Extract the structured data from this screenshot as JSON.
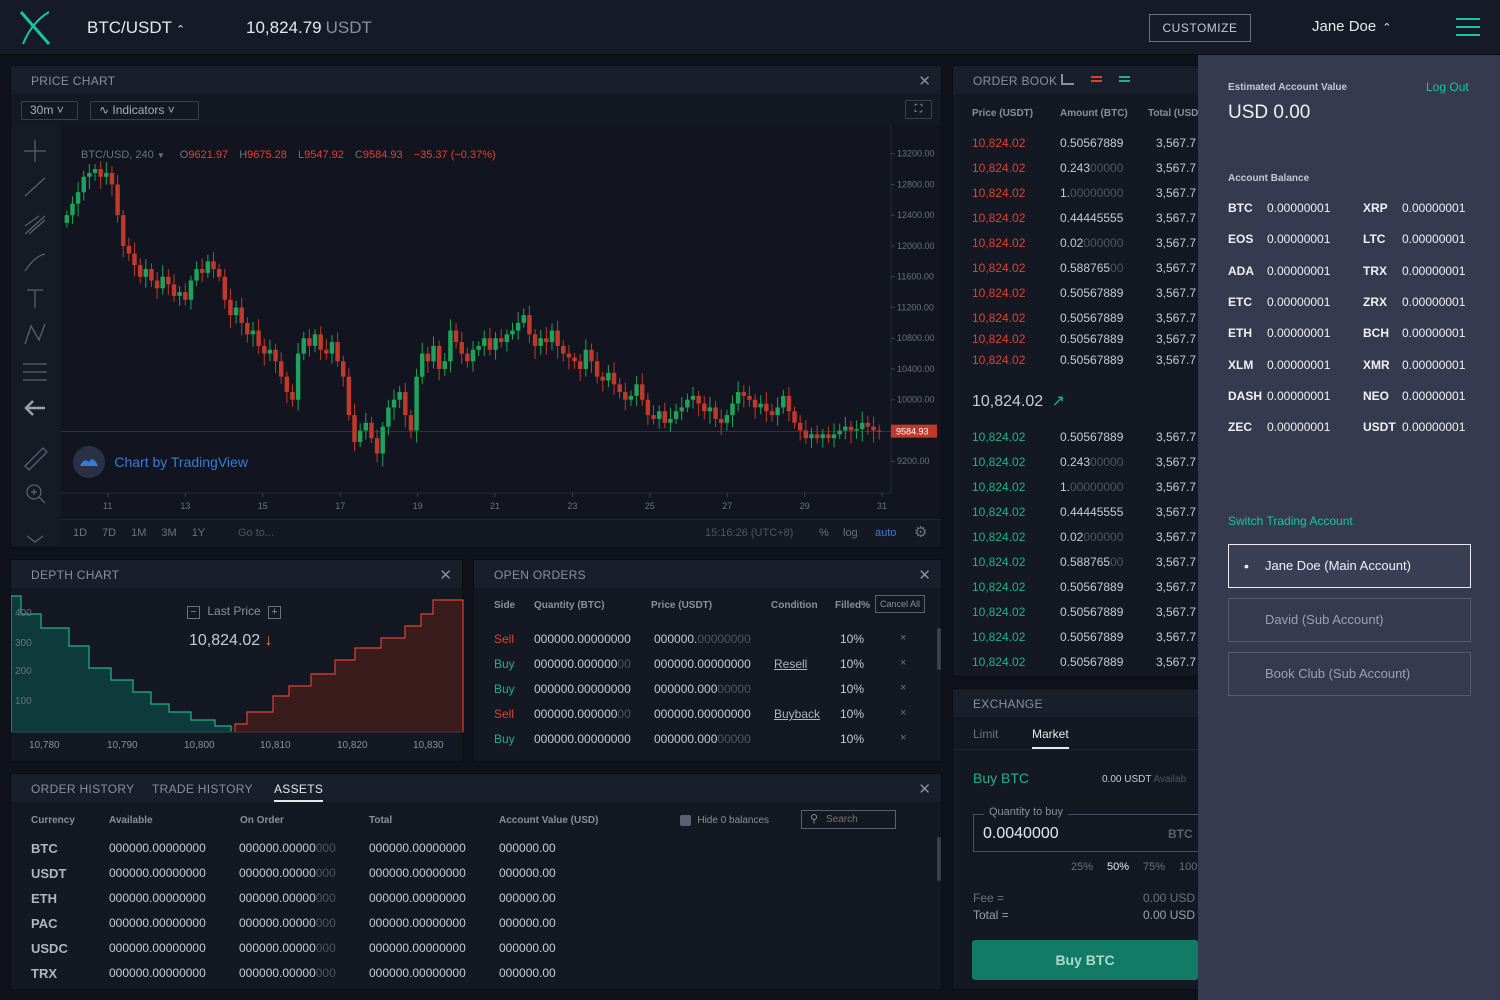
{
  "header": {
    "pair": "BTC/USDT",
    "price": "10,824.79",
    "price_unit": "USDT",
    "customize": "CUSTOMIZE",
    "user": "Jane Doe"
  },
  "price_chart": {
    "title": "PRICE CHART",
    "interval": "30m",
    "indicators": "Indicators",
    "symbol": "BTC/USD, 240",
    "o_label": "O",
    "o": "9621.97",
    "h_label": "H",
    "h": "9675.28",
    "l_label": "L",
    "l": "9547.92",
    "c_label": "C",
    "c": "9584.93",
    "change": "−35.37 (−0.37%)",
    "watermark": "Chart by TradingView",
    "last_tag": "9584.93",
    "ranges": [
      "1D",
      "7D",
      "1M",
      "3M",
      "1Y"
    ],
    "goto": "Go to...",
    "time": "15:16:26 (UTC+8)",
    "pct": "%",
    "log": "log",
    "auto": "auto"
  },
  "chart_data": {
    "type": "candlestick",
    "x_ticks": [
      "11",
      "13",
      "15",
      "17",
      "19",
      "21",
      "23",
      "25",
      "27",
      "29",
      "31"
    ],
    "y_ticks": [
      "13200.00",
      "12800.00",
      "12400.00",
      "12000.00",
      "11600.00",
      "11200.00",
      "10800.00",
      "10400.00",
      "10000.00",
      "9200.00"
    ],
    "ylim": [
      8800,
      13300
    ],
    "closes": [
      12400,
      12550,
      12700,
      12900,
      12950,
      13000,
      12900,
      12950,
      12800,
      12400,
      12000,
      11900,
      11750,
      11600,
      11700,
      11550,
      11450,
      11600,
      11500,
      11350,
      11400,
      11300,
      11550,
      11700,
      11650,
      11800,
      11700,
      11600,
      11300,
      11100,
      11200,
      11000,
      10850,
      10900,
      10700,
      10600,
      10650,
      10500,
      10300,
      10100,
      10000,
      10600,
      10800,
      10700,
      10850,
      10650,
      10600,
      10750,
      10500,
      10300,
      9800,
      9450,
      9600,
      9700,
      9500,
      9300,
      9650,
      9900,
      10000,
      10100,
      9800,
      9600,
      10300,
      10600,
      10500,
      10700,
      10400,
      10500,
      10900,
      10750,
      10600,
      10500,
      10650,
      10700,
      10800,
      10650,
      10800,
      10750,
      10850,
      10900,
      11000,
      11100,
      10850,
      10700,
      10800,
      10750,
      10900,
      10700,
      10600,
      10550,
      10500,
      10400,
      10650,
      10500,
      10300,
      10250,
      10350,
      10200,
      10100,
      10000,
      10050,
      10200,
      10000,
      9800,
      9750,
      9850,
      9700,
      9750,
      9850,
      9900,
      10000,
      10050,
      9950,
      9850,
      9900,
      9750,
      9700,
      9800,
      9950,
      10100,
      10050,
      10000,
      9900,
      9950,
      9850,
      9800,
      9900,
      10050,
      9850,
      9700,
      9600,
      9500,
      9550,
      9500,
      9550,
      9500,
      9550,
      9600,
      9650,
      9600,
      9620,
      9700,
      9650,
      9600,
      9584.93
    ],
    "last_price": 9584.93
  },
  "order_book": {
    "title": "ORDER BOOK",
    "col_price": "Price (USDT)",
    "col_amount": "Amount (BTC)",
    "col_total": "Total (USD",
    "asks": [
      {
        "price": "10,824.02",
        "amt": "0.50567889",
        "amt_dim": "",
        "total": "3,567.7"
      },
      {
        "price": "10,824.02",
        "amt": "0.243",
        "amt_dim": "00000",
        "total": "3,567.7"
      },
      {
        "price": "10,824.02",
        "amt": "1.",
        "amt_dim": "00000000",
        "total": "3,567.7"
      },
      {
        "price": "10,824.02",
        "amt": "0.44445555",
        "amt_dim": "",
        "total": "3,567.7"
      },
      {
        "price": "10,824.02",
        "amt": "0.02",
        "amt_dim": "000000",
        "total": "3,567.7"
      },
      {
        "price": "10,824.02",
        "amt": "0.588765",
        "amt_dim": "00",
        "total": "3,567.7"
      },
      {
        "price": "10,824.02",
        "amt": "0.50567889",
        "amt_dim": "",
        "total": "3,567.7"
      },
      {
        "price": "10,824.02",
        "amt": "0.50567889",
        "amt_dim": "",
        "total": "3,567.7"
      },
      {
        "price": "10,824.02",
        "amt": "0.50567889",
        "amt_dim": "",
        "total": "3,567.7"
      },
      {
        "price": "10,824.02",
        "amt": "0.50567889",
        "amt_dim": "",
        "total": "3,567.7"
      }
    ],
    "mid_price": "10,824.02",
    "bids": [
      {
        "price": "10,824.02",
        "amt": "0.50567889",
        "amt_dim": "",
        "total": "3,567.7"
      },
      {
        "price": "10,824.02",
        "amt": "0.243",
        "amt_dim": "00000",
        "total": "3,567.7"
      },
      {
        "price": "10,824.02",
        "amt": "1.",
        "amt_dim": "00000000",
        "total": "3,567.7"
      },
      {
        "price": "10,824.02",
        "amt": "0.44445555",
        "amt_dim": "",
        "total": "3,567.7"
      },
      {
        "price": "10,824.02",
        "amt": "0.02",
        "amt_dim": "000000",
        "total": "3,567.7"
      },
      {
        "price": "10,824.02",
        "amt": "0.588765",
        "amt_dim": "00",
        "total": "3,567.7"
      },
      {
        "price": "10,824.02",
        "amt": "0.50567889",
        "amt_dim": "",
        "total": "3,567.7"
      },
      {
        "price": "10,824.02",
        "amt": "0.50567889",
        "amt_dim": "",
        "total": "3,567.7"
      },
      {
        "price": "10,824.02",
        "amt": "0.50567889",
        "amt_dim": "",
        "total": "3,567.7"
      },
      {
        "price": "10,824.02",
        "amt": "0.50567889",
        "amt_dim": "",
        "total": "3,567.7"
      }
    ]
  },
  "depth_chart": {
    "title": "DEPTH CHART",
    "last_price_label": "Last Price",
    "last_price": "10,824.02",
    "y_ticks": [
      "400",
      "300",
      "200",
      "100"
    ],
    "x_ticks": [
      "10,780",
      "10,790",
      "10,800",
      "10,810",
      "10,820",
      "10,830"
    ]
  },
  "open_orders": {
    "title": "OPEN ORDERS",
    "cols": {
      "side": "Side",
      "qty": "Quantity (BTC)",
      "price": "Price (USDT)",
      "cond": "Condition",
      "filled": "Filled%"
    },
    "cancel_all": "Cancel All",
    "rows": [
      {
        "side": "Sell",
        "qty": "000000.00000000",
        "qty_dim": "",
        "price": "000000.",
        "price_dim": "00000000",
        "cond": "",
        "filled": "10%"
      },
      {
        "side": "Buy",
        "qty": "000000.000000",
        "qty_dim": "00",
        "price": "000000.00000000",
        "price_dim": "",
        "cond": "Resell",
        "filled": "10%"
      },
      {
        "side": "Buy",
        "qty": "000000.00000000",
        "qty_dim": "",
        "price": "000000.000",
        "price_dim": "00000",
        "cond": "",
        "filled": "10%"
      },
      {
        "side": "Sell",
        "qty": "000000.000000",
        "qty_dim": "00",
        "price": "000000.00000000",
        "price_dim": "",
        "cond": "Buyback",
        "filled": "10%"
      },
      {
        "side": "Buy",
        "qty": "000000.00000000",
        "qty_dim": "",
        "price": "000000.000",
        "price_dim": "00000",
        "cond": "",
        "filled": "10%"
      }
    ]
  },
  "history": {
    "tabs": [
      "ORDER HISTORY",
      "TRADE HISTORY",
      "ASSETS"
    ],
    "cols": {
      "currency": "Currency",
      "available": "Available",
      "onorder": "On Order",
      "total": "Total",
      "value": "Account Value (USD)"
    },
    "hide_zero": "Hide 0 balances",
    "search_placeholder": "Search",
    "rows": [
      {
        "cur": "BTC",
        "avail": "000000.00000000",
        "oo": "000000.00000",
        "oo_dim": "000",
        "total": "000000.00000000",
        "val": "000000.00"
      },
      {
        "cur": "USDT",
        "avail": "000000.00000000",
        "oo": "000000.00000",
        "oo_dim": "000",
        "total": "000000.00000000",
        "val": "000000.00"
      },
      {
        "cur": "ETH",
        "avail": "000000.00000000",
        "oo": "000000.00000",
        "oo_dim": "000",
        "total": "000000.00000000",
        "val": "000000.00"
      },
      {
        "cur": "PAC",
        "avail": "000000.00000000",
        "oo": "000000.00000",
        "oo_dim": "000",
        "total": "000000.00000000",
        "val": "000000.00"
      },
      {
        "cur": "USDC",
        "avail": "000000.00000000",
        "oo": "000000.00000",
        "oo_dim": "000",
        "total": "000000.00000000",
        "val": "000000.00"
      },
      {
        "cur": "TRX",
        "avail": "000000.00000000",
        "oo": "000000.00000",
        "oo_dim": "000",
        "total": "000000.00000000",
        "val": "000000.00"
      }
    ]
  },
  "exchange": {
    "title": "EXCHANGE",
    "tab_limit": "Limit",
    "tab_market": "Market",
    "buy_title": "Buy BTC",
    "available": "0.00 USDT",
    "available_label": "Availab",
    "qty_label": "Quantity to buy",
    "qty_value": "0.0040000",
    "qty_unit": "BTC",
    "pcts": [
      "25%",
      "50%",
      "75%",
      "100"
    ],
    "fee_label": "Fee =",
    "fee": "0.00 USD",
    "total_label": "Total =",
    "total": "0.00 USD",
    "buy_button": "Buy BTC"
  },
  "account": {
    "est_label": "Estimated Account Value",
    "logout": "Log Out",
    "est_value": "USD 0.00",
    "balance_label": "Account Balance",
    "balances": [
      {
        "cur": "BTC",
        "val": "0.00000001"
      },
      {
        "cur": "XRP",
        "val": "0.00000001"
      },
      {
        "cur": "EOS",
        "val": "0.00000001"
      },
      {
        "cur": "LTC",
        "val": "0.00000001"
      },
      {
        "cur": "ADA",
        "val": "0.00000001"
      },
      {
        "cur": "TRX",
        "val": "0.00000001"
      },
      {
        "cur": "ETC",
        "val": "0.00000001"
      },
      {
        "cur": "ZRX",
        "val": "0.00000001"
      },
      {
        "cur": "ETH",
        "val": "0.00000001"
      },
      {
        "cur": "BCH",
        "val": "0.00000001"
      },
      {
        "cur": "XLM",
        "val": "0.00000001"
      },
      {
        "cur": "XMR",
        "val": "0.00000001"
      },
      {
        "cur": "DASH",
        "val": "0.00000001"
      },
      {
        "cur": "NEO",
        "val": "0.00000001"
      },
      {
        "cur": "ZEC",
        "val": "0.00000001"
      },
      {
        "cur": "USDT",
        "val": "0.00000001"
      }
    ],
    "switch_label": "Switch Trading Account",
    "accounts": [
      "Jane Doe (Main Account)",
      "David (Sub Account)",
      "Book Club (Sub Account)"
    ]
  },
  "colors": {
    "accent": "#19c3a5",
    "sell": "#e0412f",
    "buy": "#1fb28a",
    "drawer": "#353a4f"
  }
}
